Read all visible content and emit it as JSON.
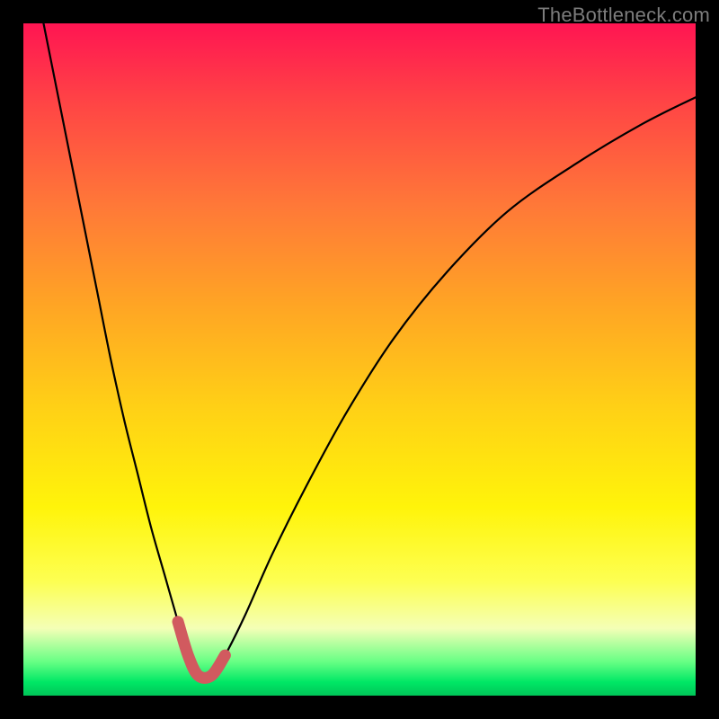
{
  "watermark": "TheBottleneck.com",
  "colors": {
    "background": "#000000",
    "curve_main": "#000000",
    "curve_highlight": "#d15a5f",
    "gradient_top": "#ff1552",
    "gradient_bottom": "#00c558"
  },
  "chart_data": {
    "type": "line",
    "title": "",
    "xlabel": "",
    "ylabel": "",
    "xlim": [
      0,
      100
    ],
    "ylim": [
      0,
      100
    ],
    "series": [
      {
        "name": "bottleneck-curve",
        "x": [
          3,
          5,
          7,
          9,
          11,
          13,
          15,
          17,
          19,
          21,
          23,
          24.5,
          26,
          28,
          30,
          33,
          37,
          42,
          48,
          55,
          63,
          72,
          82,
          92,
          100
        ],
        "y": [
          100,
          90,
          80,
          70,
          60,
          50,
          41,
          33,
          25,
          18,
          11,
          6,
          3,
          3,
          6,
          12,
          21,
          31,
          42,
          53,
          63,
          72,
          79,
          85,
          89
        ]
      }
    ],
    "highlight_range_x": [
      23,
      30
    ],
    "highlight_y_threshold": 8
  }
}
